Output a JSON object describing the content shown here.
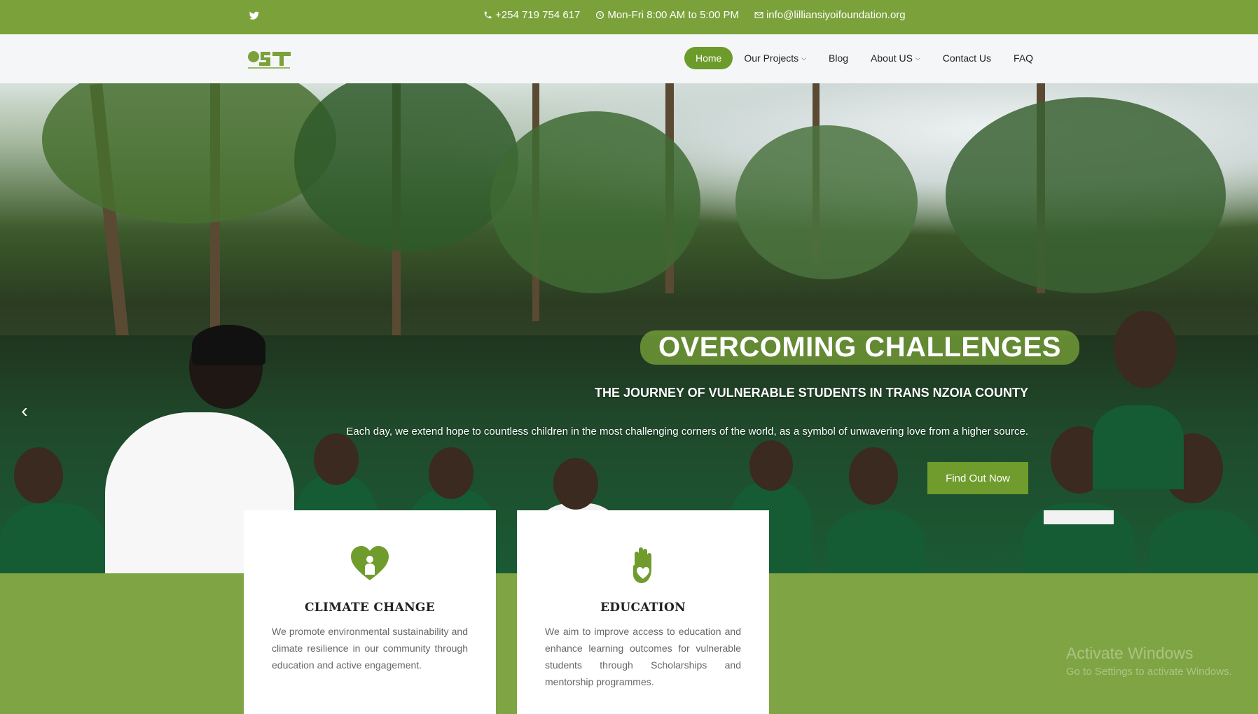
{
  "topbar": {
    "phone": "+254 719 754 617",
    "hours": "Mon-Fri 8:00 AM to 5:00 PM",
    "email": "info@lilliansiyoifoundation.org",
    "icons": {
      "social": "twitter-icon",
      "phone": "phone-icon",
      "hours": "clock-icon",
      "email": "envelope-icon"
    }
  },
  "navbar": {
    "logo_text": "LSF",
    "items": [
      {
        "label": "Home",
        "active": true
      },
      {
        "label": "Our Projects",
        "dropdown": true
      },
      {
        "label": "Blog"
      },
      {
        "label": "About US",
        "dropdown": true
      },
      {
        "label": "Contact Us"
      },
      {
        "label": "FAQ"
      }
    ]
  },
  "hero": {
    "title": "OVERCOMING CHALLENGES",
    "subtitle": "THE JOURNEY OF VULNERABLE STUDENTS IN TRANS NZOIA COUNTY",
    "description": "Each day, we extend hope to countless children in the most challenging corners of the world, as a symbol of unwavering love from a higher source.",
    "button": "Find Out Now",
    "prev_icon": "chevron-left-icon"
  },
  "cards": [
    {
      "icon": "heart-person-icon",
      "title": "CLIMATE CHANGE",
      "text": "We promote environmental sustainability and climate resilience in our community through education and active engagement."
    },
    {
      "icon": "hand-icon",
      "title": "EDUCATION",
      "text": "We aim to improve access to education and enhance learning outcomes for vulnerable students through Scholarships and mentorship programmes."
    }
  ],
  "watermark": {
    "title": "Activate Windows",
    "subtitle": "Go to Settings to activate Windows."
  },
  "colors": {
    "brand_green": "#7aa13a",
    "button_green": "#6f9c2c",
    "nav_bg": "#f5f6f7"
  }
}
